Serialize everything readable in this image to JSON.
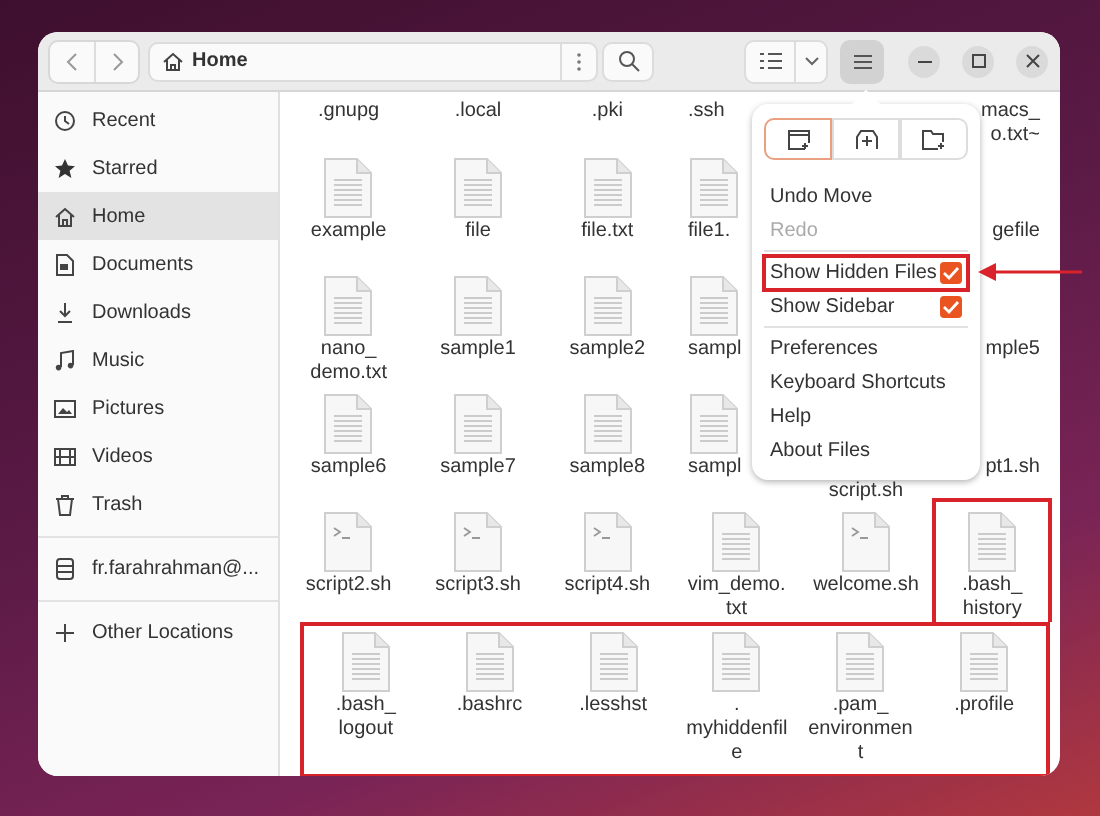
{
  "path_bar": {
    "label": "Home"
  },
  "sidebar": {
    "sections": [
      [
        {
          "label": "Recent",
          "selected": false
        },
        {
          "label": "Starred",
          "selected": false
        },
        {
          "label": "Home",
          "selected": true
        },
        {
          "label": "Documents",
          "selected": false
        },
        {
          "label": "Downloads",
          "selected": false
        },
        {
          "label": "Music",
          "selected": false
        },
        {
          "label": "Pictures",
          "selected": false
        },
        {
          "label": "Videos",
          "selected": false
        },
        {
          "label": "Trash",
          "selected": false
        }
      ],
      [
        {
          "label": "fr.farahrahman@...",
          "selected": false
        }
      ],
      [
        {
          "label": "Other Locations",
          "selected": false
        }
      ]
    ]
  },
  "files": {
    "rows": [
      {
        "outlined": false,
        "items": [
          {
            "label": ".gnupg",
            "kind": "label"
          },
          {
            "label": ".local",
            "kind": "label"
          },
          {
            "label": ".pki",
            "kind": "label"
          },
          {
            "label": ".ssh",
            "kind": "label-cut-right"
          },
          {
            "label": "macs_\no.txt~",
            "kind": "label-cut-left"
          }
        ]
      },
      {
        "outlined": false,
        "items": [
          {
            "label": "example",
            "kind": "text"
          },
          {
            "label": "file",
            "kind": "text"
          },
          {
            "label": "file.txt",
            "kind": "text"
          },
          {
            "label": "file1.",
            "kind": "cut-right"
          },
          {
            "label": "gefile",
            "kind": "cut-left"
          }
        ]
      },
      {
        "outlined": false,
        "items": [
          {
            "label": "nano_\ndemo.txt",
            "kind": "text"
          },
          {
            "label": "sample1",
            "kind": "text"
          },
          {
            "label": "sample2",
            "kind": "text"
          },
          {
            "label": "sampl",
            "kind": "cut-right"
          },
          {
            "label": "mple5",
            "kind": "cut-left"
          }
        ]
      },
      {
        "outlined": false,
        "items": [
          {
            "label": "sample6",
            "kind": "text"
          },
          {
            "label": "sample7",
            "kind": "text"
          },
          {
            "label": "sample8",
            "kind": "text"
          },
          {
            "label": "sampl",
            "kind": "cut-right"
          },
          {
            "label": "script.sh",
            "kind": "cut-top"
          },
          {
            "label": "pt1.sh",
            "kind": "cut-left"
          }
        ]
      },
      {
        "outlined": false,
        "items": [
          {
            "label": "script2.sh",
            "kind": "script",
            "outlined": false
          },
          {
            "label": "script3.sh",
            "kind": "script",
            "outlined": false
          },
          {
            "label": "script4.sh",
            "kind": "script",
            "outlined": false
          },
          {
            "label": "vim_demo.\ntxt",
            "kind": "text",
            "outlined": false
          },
          {
            "label": "welcome.sh",
            "kind": "script",
            "outlined": false
          },
          {
            "label": ".bash_\nhistory",
            "kind": "text",
            "outlined": true
          }
        ]
      },
      {
        "outlined": true,
        "items": [
          {
            "label": ".bash_\nlogout",
            "kind": "text"
          },
          {
            "label": ".bashrc",
            "kind": "text"
          },
          {
            "label": ".lesshst",
            "kind": "text"
          },
          {
            "label": ".\nmyhiddenfil\ne",
            "kind": "text"
          },
          {
            "label": ".pam_\nenvironmen\nt",
            "kind": "text"
          },
          {
            "label": ".profile",
            "kind": "text"
          }
        ]
      }
    ]
  },
  "menu": {
    "actions": [
      {
        "kind": "new-window",
        "selected": true
      },
      {
        "kind": "new-tab",
        "selected": false
      },
      {
        "kind": "new-folder",
        "selected": false
      }
    ],
    "items": [
      {
        "kind": "action",
        "label": "Undo Move",
        "disabled": false
      },
      {
        "kind": "action",
        "label": "Redo",
        "disabled": true
      },
      {
        "kind": "separator"
      },
      {
        "kind": "check",
        "label": "Show Hidden Files",
        "checked": true,
        "outlined": true
      },
      {
        "kind": "check",
        "label": "Show Sidebar",
        "checked": true,
        "outlined": false
      },
      {
        "kind": "separator"
      },
      {
        "kind": "action",
        "label": "Preferences",
        "disabled": false
      },
      {
        "kind": "action",
        "label": "Keyboard Shortcuts",
        "disabled": false
      },
      {
        "kind": "action",
        "label": "Help",
        "disabled": false
      },
      {
        "kind": "action",
        "label": "About Files",
        "disabled": false
      }
    ]
  }
}
